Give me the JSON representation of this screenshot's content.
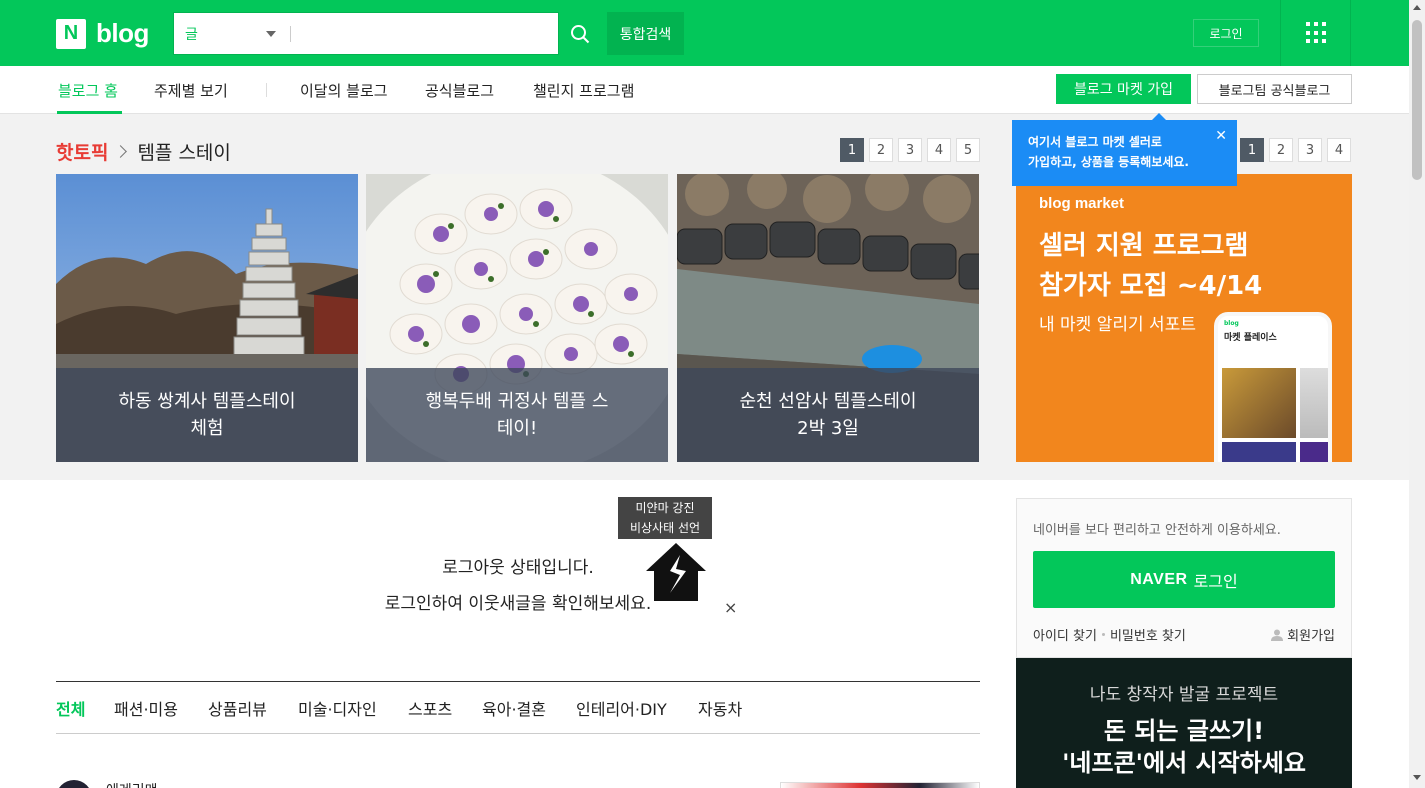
{
  "header": {
    "logo_n": "N",
    "logo_text": "blog",
    "search_scope": "글",
    "search_placeholder": "",
    "unified_search": "통합검색",
    "login": "로그인"
  },
  "nav": {
    "items": [
      "블로그 홈",
      "주제별 보기",
      "이달의 블로그",
      "공식블로그",
      "챌린지 프로그램"
    ],
    "market_join": "블로그 마켓 가입",
    "official_blog": "블로그팀 공식블로그"
  },
  "tooltip": {
    "line1": "여기서 블로그 마켓 셀러로",
    "line2": "가입하고, 상품을 등록해보세요.",
    "close": "✕"
  },
  "hot_topic": {
    "label": "핫토픽",
    "topic": "템플 스테이",
    "pages": [
      "1",
      "2",
      "3",
      "4",
      "5"
    ],
    "cards": [
      {
        "line1": "하동 쌍계사 템플스테이",
        "line2": "체험"
      },
      {
        "line1": "행복두배 귀정사 템플 스",
        "line2": "테이!"
      },
      {
        "line1": "순천 선암사 템플스테이",
        "line2": "2박 3일"
      }
    ]
  },
  "ad": {
    "pages": [
      "1",
      "2",
      "3",
      "4"
    ],
    "brand": "blog market",
    "headline1": "셀러 지원 프로그램",
    "headline2": "참가자 모집 ~4/14",
    "sub": "내 마켓 알리기 서포트",
    "phone_blog": "blog",
    "phone_title": "마켓 플레이스"
  },
  "emergency": {
    "line1": "미얀마 강진",
    "line2": "비상사태 선언",
    "close": "×"
  },
  "logout": {
    "line1": "로그아웃 상태입니다.",
    "line2": "로그인하여 이웃새글을 확인해보세요."
  },
  "categories": [
    "전체",
    "패션·미용",
    "상품리뷰",
    "미술·디자인",
    "스포츠",
    "육아·결혼",
    "인테리어·DIY",
    "자동차"
  ],
  "post_peek": {
    "name": "에레리맨"
  },
  "login_box": {
    "desc": "네이버를 보다 편리하고 안전하게 이용하세요.",
    "naver": "NAVER",
    "login": "로그인",
    "find_id": "아이디 찾기",
    "find_pw": "비밀번호 찾기",
    "signup": "회원가입"
  },
  "promo": {
    "sub": "나도 창작자 발굴 프로젝트",
    "line1": "돈 되는 글쓰기!",
    "line2": "'네프콘'에서 시작하세요"
  },
  "colors": {
    "brand": "#03c75a",
    "hot": "#e83c35",
    "tooltip": "#1b8cf5",
    "ad": "#f2861d"
  }
}
